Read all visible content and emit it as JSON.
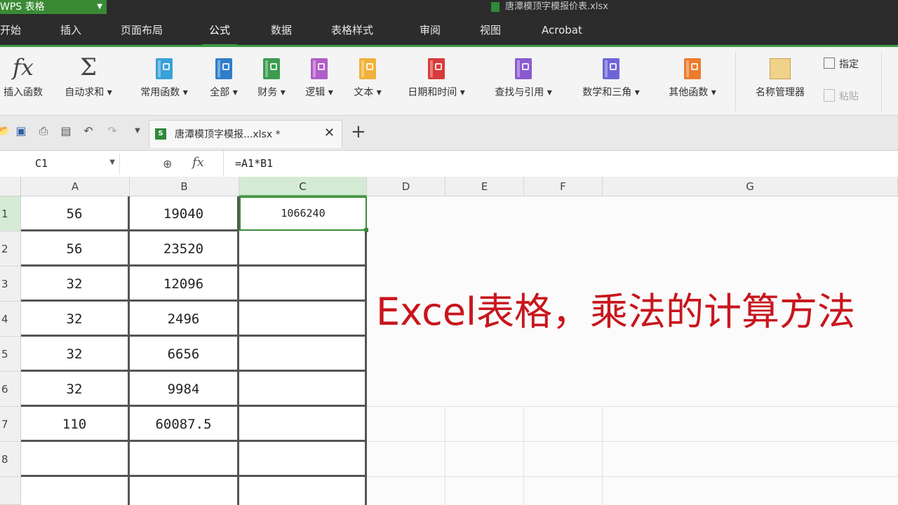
{
  "app": {
    "name": "WPS 表格",
    "window_title": "唐潭模顶字模报价表.xlsx"
  },
  "menu_tabs": [
    "开始",
    "插入",
    "页面布局",
    "公式",
    "数据",
    "表格样式",
    "审阅",
    "视图",
    "Acrobat"
  ],
  "active_tab": "公式",
  "ribbon": {
    "insert_function": "插入函数",
    "autosum": "自动求和",
    "common": "常用函数",
    "all": "全部",
    "finance": "财务",
    "logic": "逻辑",
    "text": "文本",
    "datetime": "日期和时间",
    "lookup": "查找与引用",
    "math": "数学和三角",
    "other": "其他函数",
    "name_manager": "名称管理器",
    "specify": "指定",
    "paste": "粘贴",
    "colors": {
      "common": "#3aa0d8",
      "all": "#2f7ecb",
      "finance": "#3b9b4f",
      "logic": "#b25cc8",
      "text": "#f1b13a",
      "datetime": "#d93a3a",
      "lookup": "#8a5ad0",
      "math": "#6f64d6",
      "other": "#ec7b2e"
    }
  },
  "file_tab": {
    "name": "唐潭模顶字模报...xlsx",
    "modified_mark": "*"
  },
  "formula_bar": {
    "name_box": "C1",
    "formula": "=A1*B1"
  },
  "columns": [
    "A",
    "B",
    "C",
    "D",
    "E",
    "F",
    "G"
  ],
  "selected_column": "C",
  "rows": [
    {
      "num": "1",
      "a": "56",
      "b": "19040",
      "c": "1066240"
    },
    {
      "num": "2",
      "a": "56",
      "b": "23520",
      "c": ""
    },
    {
      "num": "3",
      "a": "32",
      "b": "12096",
      "c": ""
    },
    {
      "num": "4",
      "a": "32",
      "b": "2496",
      "c": ""
    },
    {
      "num": "5",
      "a": "32",
      "b": "6656",
      "c": ""
    },
    {
      "num": "6",
      "a": "32",
      "b": "9984",
      "c": ""
    },
    {
      "num": "7",
      "a": "110",
      "b": "60087.5",
      "c": ""
    },
    {
      "num": "8",
      "a": "",
      "b": "",
      "c": ""
    }
  ],
  "caption": "Excel表格，乘法的计算方法"
}
